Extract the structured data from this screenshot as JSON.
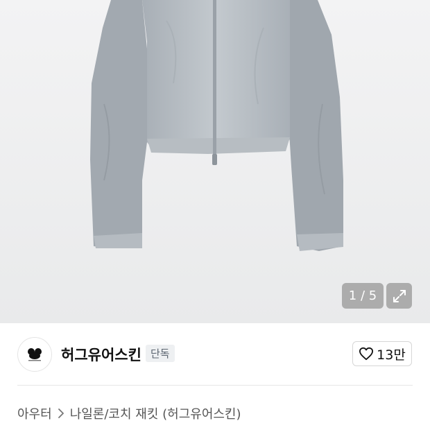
{
  "gallery": {
    "current_page": 1,
    "total_pages": 5,
    "counter_text": "1 / 5",
    "icons": {
      "expand": "expand-arrows-icon"
    }
  },
  "brand": {
    "name": "허그유어스킨",
    "badge": "단독",
    "logo_icon": "brand-logo-icon"
  },
  "like": {
    "count": "13만",
    "icon": "heart-outline-icon"
  },
  "breadcrumb": {
    "items": [
      "아우터",
      "나일론/코치 재킷 (허그유어스킨)"
    ],
    "separator_icon": "chevron-right-icon"
  }
}
